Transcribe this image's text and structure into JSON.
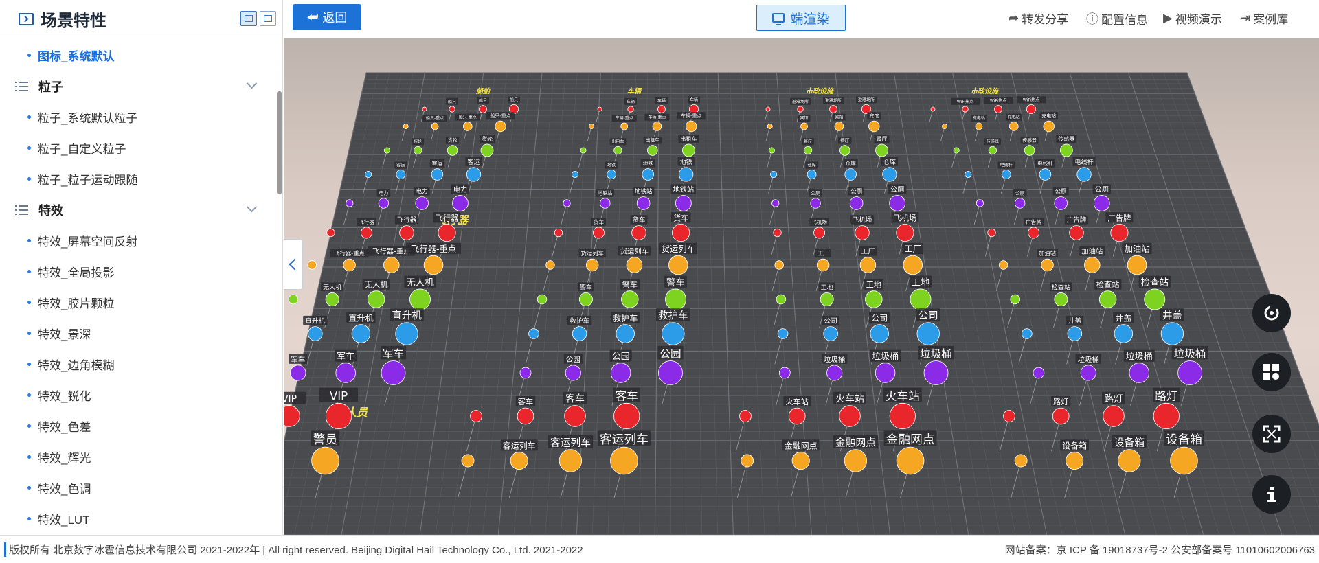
{
  "sidebar": {
    "title": "场景特性",
    "selected_item": "图标_系统默认",
    "groups": [
      {
        "label": "粒子",
        "items": [
          "粒子_系统默认粒子",
          "粒子_自定义粒子",
          "粒子_粒子运动跟随"
        ]
      },
      {
        "label": "特效",
        "items": [
          "特效_屏幕空间反射",
          "特效_全局投影",
          "特效_胶片颗粒",
          "特效_景深",
          "特效_边角模糊",
          "特效_锐化",
          "特效_色差",
          "特效_辉光",
          "特效_色调",
          "特效_LUT"
        ]
      }
    ]
  },
  "toolbar": {
    "back_label": "返回",
    "render_label": "端渲染",
    "actions": [
      {
        "label": "转发分享",
        "icon": "share-icon"
      },
      {
        "label": "配置信息",
        "icon": "info-circle-icon"
      },
      {
        "label": "视频演示",
        "icon": "play-circle-icon"
      },
      {
        "label": "案例库",
        "icon": "library-icon"
      }
    ]
  },
  "scene": {
    "category_labels": [
      "船舶",
      "车辆",
      "市政设施",
      "市政设施",
      "飞行器",
      "人员"
    ],
    "icon_colors": [
      "#e8262b",
      "#f5a623",
      "#7ed321",
      "#2c9be8",
      "#8b2be8"
    ],
    "rows": [
      {
        "color": "#e8262b",
        "labels": [
          "船只",
          "车辆",
          "避难场所",
          "WiFi热点"
        ]
      },
      {
        "color": "#f5a623",
        "labels": [
          "船只-重点",
          "车辆-重点",
          "宾馆",
          "充电站"
        ]
      },
      {
        "color": "#7ed321",
        "labels": [
          "货轮",
          "出租车",
          "餐厅",
          "传感器"
        ]
      },
      {
        "color": "#2c9be8",
        "labels": [
          "客运",
          "地铁",
          "仓库",
          "电线杆"
        ]
      },
      {
        "color": "#8b2be8",
        "labels": [
          "电力",
          "地铁站",
          "公厕"
        ]
      },
      {
        "color": "#e8262b",
        "labels": [
          "飞行器",
          "货车",
          "飞机场",
          "广告牌"
        ]
      },
      {
        "color": "#f5a623",
        "labels": [
          "飞行器-重点",
          "货运列车",
          "工厂",
          "加油站"
        ]
      },
      {
        "color": "#7ed321",
        "labels": [
          "无人机",
          "警车",
          "工地",
          "检查站"
        ]
      },
      {
        "color": "#2c9be8",
        "labels": [
          "直升机",
          "救护车",
          "公司",
          "井盖"
        ]
      },
      {
        "color": "#8b2be8",
        "labels": [
          "军车",
          "公园",
          "垃圾桶"
        ]
      },
      {
        "color": "#e8262b",
        "labels": [
          "VIP",
          "客车",
          "火车站",
          "路灯"
        ]
      },
      {
        "color": "#f5a623",
        "labels": [
          "警员",
          "客运列车",
          "金融网点",
          "设备箱"
        ]
      }
    ]
  },
  "float_buttons": [
    "rotate-view-icon",
    "layout-icon",
    "fullscreen-icon",
    "info-icon"
  ],
  "footer": {
    "copyright": "版权所有 北京数字冰雹信息技术有限公司 2021-2022年 | All right reserved. Beijing Digital Hail Technology Co., Ltd. 2021-2022",
    "record": "网站备案：京 ICP 备 19018737号-2 公安部备案号 11010602006763"
  }
}
